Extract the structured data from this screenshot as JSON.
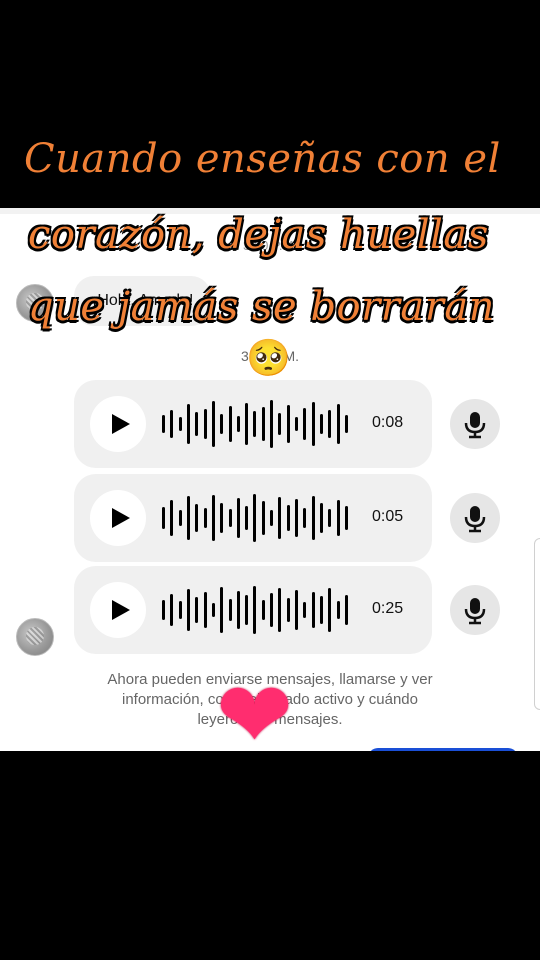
{
  "caption": {
    "line1": "Cuando enseñas con el",
    "line2": "corazón, dejas huellas",
    "line3": "que jamás se borrarán"
  },
  "chat": {
    "faded_time": "3:00 P.M.",
    "greeting": "¡Hola, Amada!",
    "time_label": "3:00 P.M.",
    "audio_messages": [
      {
        "duration": "0:08"
      },
      {
        "duration": "0:05"
      },
      {
        "duration": "0:25"
      }
    ],
    "info_text_line1": "Ahora pueden enviarse mensajes, llamarse y ver",
    "info_text_line2": "información, como el estado activo y cuándo",
    "info_text_line3": "leyeron los mensajes."
  },
  "stickers": {
    "pleading_emoji": "🥺",
    "heart": "❤"
  },
  "colors": {
    "caption": "#f08036",
    "bubble": "#f0f0f0",
    "heart": "#ff2d6f"
  }
}
